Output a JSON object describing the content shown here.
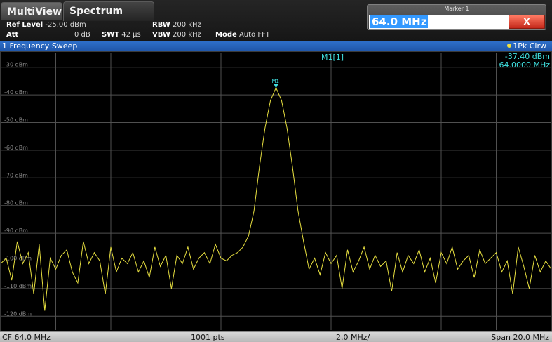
{
  "tabs": [
    {
      "label": "MultiView"
    },
    {
      "label": "Spectrum"
    }
  ],
  "header": {
    "ref_level_label": "Ref Level",
    "ref_level_value": "-25.00 dBm",
    "att_label": "Att",
    "att_value": "0 dB",
    "swt_label": "SWT",
    "swt_value": "42 µs",
    "rbw_label": "RBW",
    "rbw_value": "200 kHz",
    "vbw_label": "VBW",
    "vbw_value": "200 kHz",
    "mode_label": "Mode",
    "mode_value": "Auto FFT"
  },
  "marker_dialog": {
    "title": "Marker 1",
    "value": "64.0 MHz",
    "close_label": "X"
  },
  "trace_window": {
    "title": "1 Frequency Sweep",
    "trace_info": "1Pk Clrw",
    "marker_label": "M1[1]",
    "marker_level": "-37.40 dBm",
    "marker_freq": "64.0000 MHz",
    "marker_tag": "M1"
  },
  "footer": {
    "center_freq": "CF 64.0 MHz",
    "points": "1001 pts",
    "div": "2.0 MHz/",
    "span": "Span 20.0 MHz"
  },
  "colors": {
    "trace": "#e8e040",
    "marker": "#40e0e0",
    "grid": "#505050",
    "title_bar": "#2563b8"
  },
  "chart_data": {
    "type": "line",
    "y_tick_labels": [
      "-30 dBm",
      "-40 dBm",
      "-50 dBm",
      "-60 dBm",
      "-70 dBm",
      "-80 dBm",
      "-90 dBm",
      "-100 dBm",
      "-110 dBm",
      "-120 dBm"
    ],
    "y_ticks": [
      -30,
      -40,
      -50,
      -60,
      -70,
      -80,
      -90,
      -100,
      -110,
      -120
    ],
    "ylim": [
      -125,
      -25
    ],
    "xlim": [
      54.0,
      74.0
    ],
    "x_unit": "MHz",
    "y_unit": "dBm",
    "grid": true,
    "series": [
      {
        "x": [
          54.0,
          54.2,
          54.4,
          54.6,
          54.8,
          55.0,
          55.2,
          55.4,
          55.6,
          55.8,
          56.0,
          56.2,
          56.4,
          56.6,
          56.8,
          57.0,
          57.2,
          57.4,
          57.6,
          57.8,
          58.0,
          58.2,
          58.4,
          58.6,
          58.8,
          59.0,
          59.2,
          59.4,
          59.6,
          59.8,
          60.0,
          60.2,
          60.4,
          60.6,
          60.8,
          61.0,
          61.2,
          61.4,
          61.6,
          61.8,
          62.0,
          62.2,
          62.4,
          62.6,
          62.8,
          63.0,
          63.2,
          63.4,
          63.6,
          63.8,
          64.0,
          64.2,
          64.4,
          64.6,
          64.8,
          65.0,
          65.2,
          65.4,
          65.6,
          65.8,
          66.0,
          66.2,
          66.4,
          66.6,
          66.8,
          67.0,
          67.2,
          67.4,
          67.6,
          67.8,
          68.0,
          68.2,
          68.4,
          68.6,
          68.8,
          69.0,
          69.2,
          69.4,
          69.6,
          69.8,
          70.0,
          70.2,
          70.4,
          70.6,
          70.8,
          71.0,
          71.2,
          71.4,
          71.6,
          71.8,
          72.0,
          72.2,
          72.4,
          72.6,
          72.8,
          73.0,
          73.2,
          73.4,
          73.6,
          73.8,
          74.0
        ],
        "y": [
          -101,
          -99,
          -107,
          -93,
          -101,
          -97,
          -112,
          -94,
          -118,
          -99,
          -103,
          -98,
          -96,
          -104,
          -108,
          -93,
          -101,
          -97,
          -100,
          -112,
          -95,
          -104,
          -99,
          -101,
          -97,
          -104,
          -100,
          -106,
          -95,
          -102,
          -98,
          -110,
          -98,
          -101,
          -95,
          -103,
          -99,
          -97,
          -101,
          -94,
          -99,
          -100,
          -98,
          -97,
          -95,
          -91,
          -82,
          -66,
          -52,
          -42,
          -37.4,
          -42,
          -52,
          -66,
          -82,
          -93,
          -103,
          -99,
          -105,
          -97,
          -101,
          -98,
          -110,
          -96,
          -104,
          -100,
          -95,
          -103,
          -98,
          -102,
          -100,
          -111,
          -97,
          -104,
          -98,
          -101,
          -96,
          -104,
          -99,
          -108,
          -97,
          -101,
          -95,
          -103,
          -100,
          -98,
          -106,
          -96,
          -101,
          -99,
          -97,
          -104,
          -100,
          -112,
          -95,
          -102,
          -110,
          -98,
          -104,
          -100,
          -103
        ]
      }
    ]
  }
}
